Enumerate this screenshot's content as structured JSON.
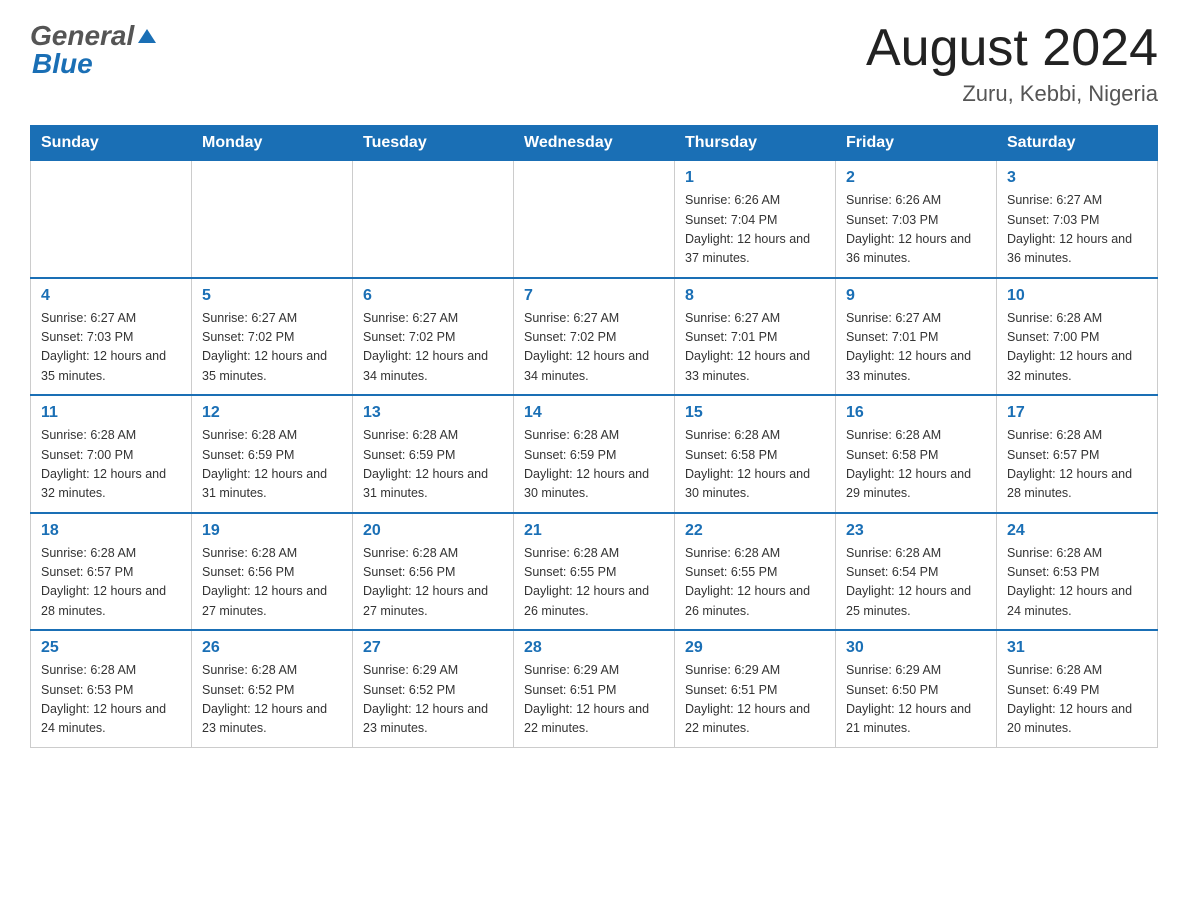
{
  "header": {
    "logo_general": "General",
    "logo_blue": "Blue",
    "month_title": "August 2024",
    "location": "Zuru, Kebbi, Nigeria"
  },
  "weekdays": [
    "Sunday",
    "Monday",
    "Tuesday",
    "Wednesday",
    "Thursday",
    "Friday",
    "Saturday"
  ],
  "weeks": [
    [
      {
        "day": "",
        "sunrise": "",
        "sunset": "",
        "daylight": ""
      },
      {
        "day": "",
        "sunrise": "",
        "sunset": "",
        "daylight": ""
      },
      {
        "day": "",
        "sunrise": "",
        "sunset": "",
        "daylight": ""
      },
      {
        "day": "",
        "sunrise": "",
        "sunset": "",
        "daylight": ""
      },
      {
        "day": "1",
        "sunrise": "Sunrise: 6:26 AM",
        "sunset": "Sunset: 7:04 PM",
        "daylight": "Daylight: 12 hours and 37 minutes."
      },
      {
        "day": "2",
        "sunrise": "Sunrise: 6:26 AM",
        "sunset": "Sunset: 7:03 PM",
        "daylight": "Daylight: 12 hours and 36 minutes."
      },
      {
        "day": "3",
        "sunrise": "Sunrise: 6:27 AM",
        "sunset": "Sunset: 7:03 PM",
        "daylight": "Daylight: 12 hours and 36 minutes."
      }
    ],
    [
      {
        "day": "4",
        "sunrise": "Sunrise: 6:27 AM",
        "sunset": "Sunset: 7:03 PM",
        "daylight": "Daylight: 12 hours and 35 minutes."
      },
      {
        "day": "5",
        "sunrise": "Sunrise: 6:27 AM",
        "sunset": "Sunset: 7:02 PM",
        "daylight": "Daylight: 12 hours and 35 minutes."
      },
      {
        "day": "6",
        "sunrise": "Sunrise: 6:27 AM",
        "sunset": "Sunset: 7:02 PM",
        "daylight": "Daylight: 12 hours and 34 minutes."
      },
      {
        "day": "7",
        "sunrise": "Sunrise: 6:27 AM",
        "sunset": "Sunset: 7:02 PM",
        "daylight": "Daylight: 12 hours and 34 minutes."
      },
      {
        "day": "8",
        "sunrise": "Sunrise: 6:27 AM",
        "sunset": "Sunset: 7:01 PM",
        "daylight": "Daylight: 12 hours and 33 minutes."
      },
      {
        "day": "9",
        "sunrise": "Sunrise: 6:27 AM",
        "sunset": "Sunset: 7:01 PM",
        "daylight": "Daylight: 12 hours and 33 minutes."
      },
      {
        "day": "10",
        "sunrise": "Sunrise: 6:28 AM",
        "sunset": "Sunset: 7:00 PM",
        "daylight": "Daylight: 12 hours and 32 minutes."
      }
    ],
    [
      {
        "day": "11",
        "sunrise": "Sunrise: 6:28 AM",
        "sunset": "Sunset: 7:00 PM",
        "daylight": "Daylight: 12 hours and 32 minutes."
      },
      {
        "day": "12",
        "sunrise": "Sunrise: 6:28 AM",
        "sunset": "Sunset: 6:59 PM",
        "daylight": "Daylight: 12 hours and 31 minutes."
      },
      {
        "day": "13",
        "sunrise": "Sunrise: 6:28 AM",
        "sunset": "Sunset: 6:59 PM",
        "daylight": "Daylight: 12 hours and 31 minutes."
      },
      {
        "day": "14",
        "sunrise": "Sunrise: 6:28 AM",
        "sunset": "Sunset: 6:59 PM",
        "daylight": "Daylight: 12 hours and 30 minutes."
      },
      {
        "day": "15",
        "sunrise": "Sunrise: 6:28 AM",
        "sunset": "Sunset: 6:58 PM",
        "daylight": "Daylight: 12 hours and 30 minutes."
      },
      {
        "day": "16",
        "sunrise": "Sunrise: 6:28 AM",
        "sunset": "Sunset: 6:58 PM",
        "daylight": "Daylight: 12 hours and 29 minutes."
      },
      {
        "day": "17",
        "sunrise": "Sunrise: 6:28 AM",
        "sunset": "Sunset: 6:57 PM",
        "daylight": "Daylight: 12 hours and 28 minutes."
      }
    ],
    [
      {
        "day": "18",
        "sunrise": "Sunrise: 6:28 AM",
        "sunset": "Sunset: 6:57 PM",
        "daylight": "Daylight: 12 hours and 28 minutes."
      },
      {
        "day": "19",
        "sunrise": "Sunrise: 6:28 AM",
        "sunset": "Sunset: 6:56 PM",
        "daylight": "Daylight: 12 hours and 27 minutes."
      },
      {
        "day": "20",
        "sunrise": "Sunrise: 6:28 AM",
        "sunset": "Sunset: 6:56 PM",
        "daylight": "Daylight: 12 hours and 27 minutes."
      },
      {
        "day": "21",
        "sunrise": "Sunrise: 6:28 AM",
        "sunset": "Sunset: 6:55 PM",
        "daylight": "Daylight: 12 hours and 26 minutes."
      },
      {
        "day": "22",
        "sunrise": "Sunrise: 6:28 AM",
        "sunset": "Sunset: 6:55 PM",
        "daylight": "Daylight: 12 hours and 26 minutes."
      },
      {
        "day": "23",
        "sunrise": "Sunrise: 6:28 AM",
        "sunset": "Sunset: 6:54 PM",
        "daylight": "Daylight: 12 hours and 25 minutes."
      },
      {
        "day": "24",
        "sunrise": "Sunrise: 6:28 AM",
        "sunset": "Sunset: 6:53 PM",
        "daylight": "Daylight: 12 hours and 24 minutes."
      }
    ],
    [
      {
        "day": "25",
        "sunrise": "Sunrise: 6:28 AM",
        "sunset": "Sunset: 6:53 PM",
        "daylight": "Daylight: 12 hours and 24 minutes."
      },
      {
        "day": "26",
        "sunrise": "Sunrise: 6:28 AM",
        "sunset": "Sunset: 6:52 PM",
        "daylight": "Daylight: 12 hours and 23 minutes."
      },
      {
        "day": "27",
        "sunrise": "Sunrise: 6:29 AM",
        "sunset": "Sunset: 6:52 PM",
        "daylight": "Daylight: 12 hours and 23 minutes."
      },
      {
        "day": "28",
        "sunrise": "Sunrise: 6:29 AM",
        "sunset": "Sunset: 6:51 PM",
        "daylight": "Daylight: 12 hours and 22 minutes."
      },
      {
        "day": "29",
        "sunrise": "Sunrise: 6:29 AM",
        "sunset": "Sunset: 6:51 PM",
        "daylight": "Daylight: 12 hours and 22 minutes."
      },
      {
        "day": "30",
        "sunrise": "Sunrise: 6:29 AM",
        "sunset": "Sunset: 6:50 PM",
        "daylight": "Daylight: 12 hours and 21 minutes."
      },
      {
        "day": "31",
        "sunrise": "Sunrise: 6:28 AM",
        "sunset": "Sunset: 6:49 PM",
        "daylight": "Daylight: 12 hours and 20 minutes."
      }
    ]
  ]
}
